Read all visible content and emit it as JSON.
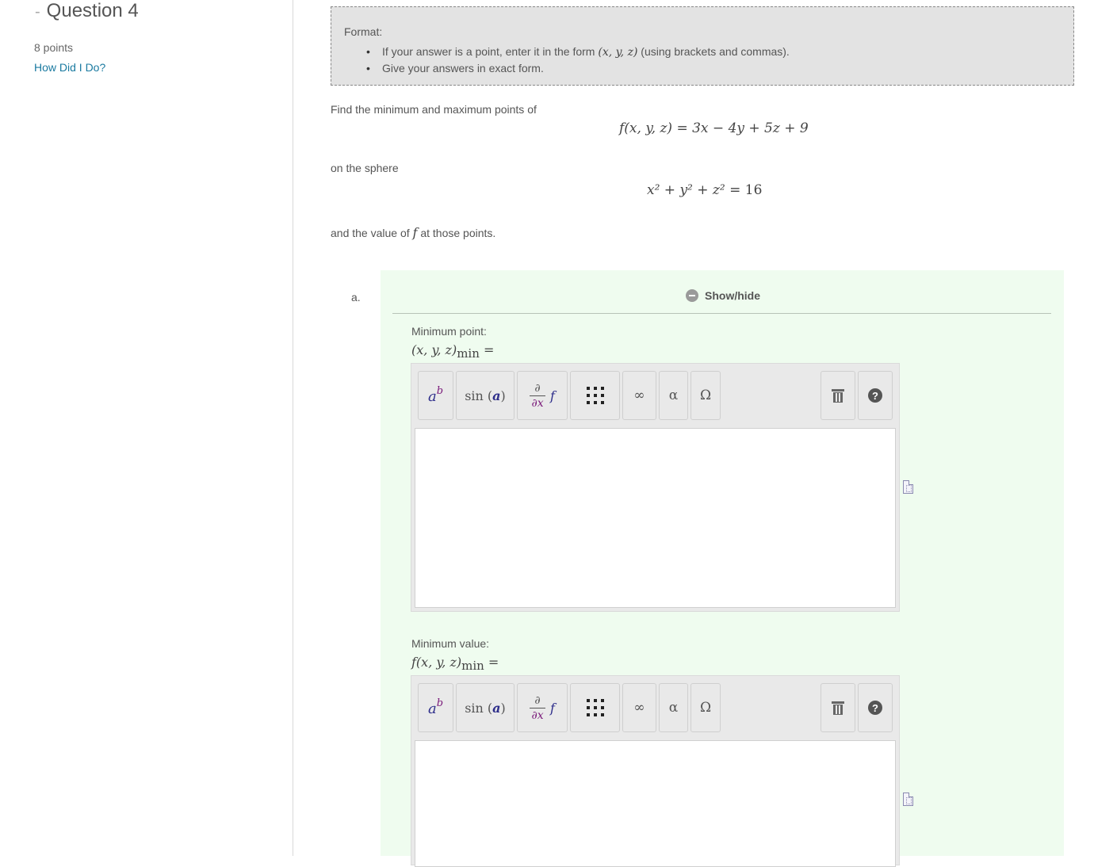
{
  "sidebar": {
    "title_dash": "-",
    "title": "Question 4",
    "points": "8 points",
    "how_link": "How Did I Do?"
  },
  "format": {
    "label": "Format:",
    "bullet1_pre": "If your answer is a point, enter it in the form",
    "bullet1_math": "(x, y, z)",
    "bullet1_post": "(using brackets and commas).",
    "bullet2": "Give your answers in exact form."
  },
  "problem": {
    "line1": "Find the minimum and maximum points of",
    "eq1": "f(x, y, z) = 3x − 4y + 5z + 9",
    "line2": "on the sphere",
    "eq2_lhs": "x² + y² + z²",
    "eq2_rhs": "= 16",
    "line3_pre": "and the value of",
    "line3_var": "f",
    "line3_post": "at those points."
  },
  "part_a": {
    "label": "a.",
    "showhide": "Show/hide",
    "min_point_label": "Minimum point:",
    "min_point_math": "(x, y, z)",
    "min_point_sub": "min",
    "min_point_eq": "=",
    "min_value_label": "Minimum value:",
    "min_value_math": "f(x, y, z)",
    "min_value_sub": "min",
    "min_value_eq": "="
  },
  "toolbar": {
    "sup_base": "a",
    "sup_exp": "b",
    "sin_text": "sin",
    "sin_arg": "a",
    "deriv_top": "∂",
    "deriv_bot": "∂x",
    "deriv_f": "f",
    "infinity": "∞",
    "alpha": "α",
    "omega": "Ω",
    "help": "?"
  },
  "icons": {
    "matrix": "matrix-grid-icon",
    "trash": "trash-icon",
    "help": "help-icon",
    "document": "document-icon",
    "collapse": "minus-circle-icon"
  },
  "colors": {
    "panel_bg": "#effcef",
    "format_bg": "#e3e3e3",
    "link": "#1a7aa0"
  }
}
